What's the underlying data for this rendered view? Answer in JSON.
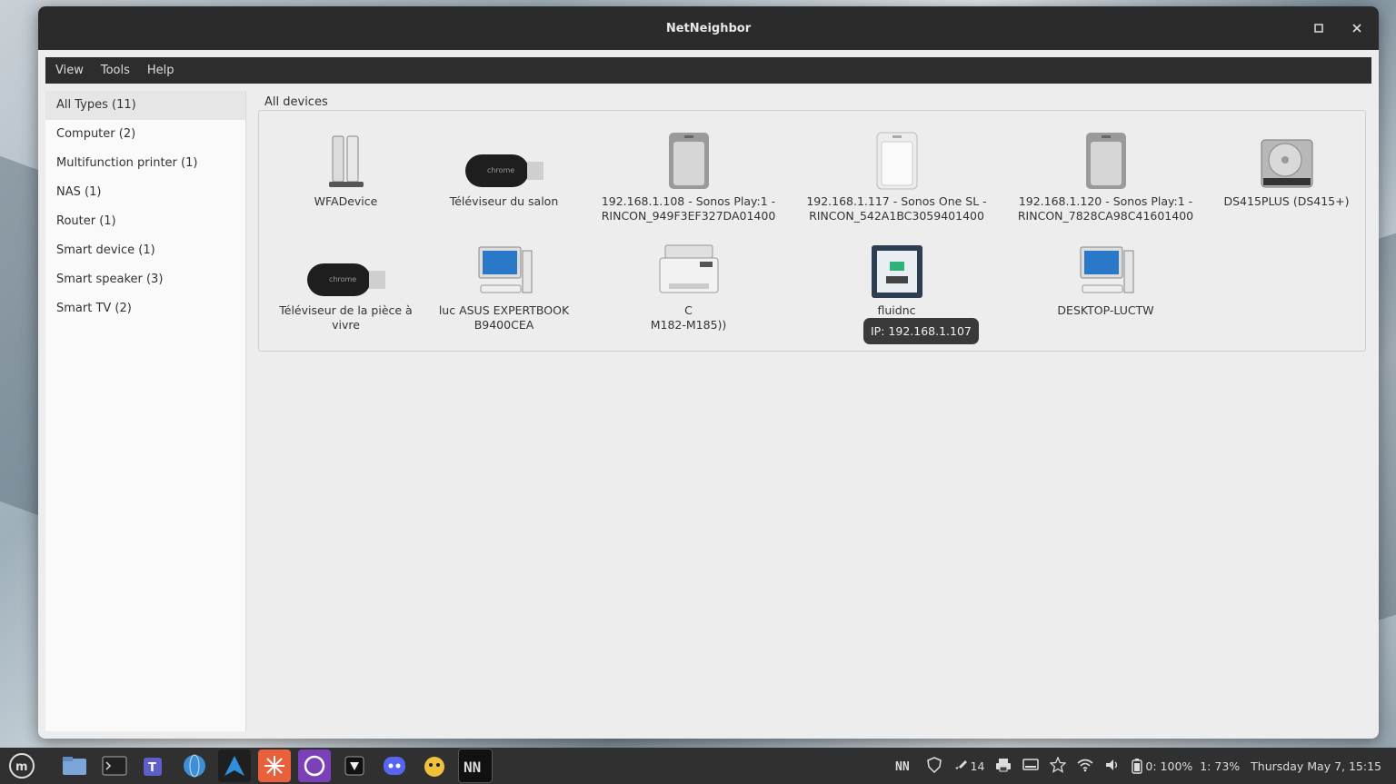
{
  "window": {
    "title": "NetNeighbor"
  },
  "menu": [
    "View",
    "Tools",
    "Help"
  ],
  "sidebar": {
    "items": [
      "All Types (11)",
      "Computer (2)",
      "Multifunction printer (1)",
      "NAS (1)",
      "Router (1)",
      "Smart device (1)",
      "Smart speaker (3)",
      "Smart TV (2)"
    ]
  },
  "main": {
    "group_label": "All devices",
    "devices": [
      {
        "l1": "WFADevice",
        "l2": "",
        "l3": "",
        "icon": "router-icon"
      },
      {
        "l1": "Téléviseur du salon",
        "l2": "",
        "l3": "",
        "icon": "chromecast-icon"
      },
      {
        "l1": "192.168.1.108 - Sonos Play:1 -",
        "l2": "RINCON_949F3EF327DA01400",
        "l3": "",
        "icon": "sonos-speaker-icon"
      },
      {
        "l1": "192.168.1.117 - Sonos One SL -",
        "l2": "RINCON_542A1BC3059401400",
        "l3": "",
        "icon": "sonos-white-speaker-icon"
      },
      {
        "l1": "192.168.1.120 - Sonos Play:1 -",
        "l2": "RINCON_7828CA98C41601400",
        "l3": "",
        "icon": "sonos-speaker-icon"
      },
      {
        "l1": "DS415PLUS (DS415+)",
        "l2": "",
        "l3": "",
        "icon": "nas-drive-icon"
      },
      {
        "l1": "Téléviseur de la pièce à",
        "l2": "vivre",
        "l3": "",
        "icon": "chromecast-icon"
      },
      {
        "l1": "luc ASUS EXPERTBOOK",
        "l2": "B9400CEA",
        "l3": "",
        "icon": "desktop-computer-icon"
      },
      {
        "l1": "",
        "l2": "C",
        "l3": "M182-M185))",
        "icon": "printer-icon"
      },
      {
        "l1": "fluidnc",
        "l2": "",
        "l3": "",
        "icon": "3d-printer-icon"
      },
      {
        "l1": "DESKTOP-LUCTW",
        "l2": "",
        "l3": "",
        "icon": "desktop-computer-icon"
      }
    ],
    "tooltip": "IP: 192.168.1.107"
  },
  "taskbar": {
    "tray": {
      "notifications": "14",
      "battery": "0: 100%  1: 73%",
      "clock": "Thursday May 7, 15:15"
    }
  }
}
